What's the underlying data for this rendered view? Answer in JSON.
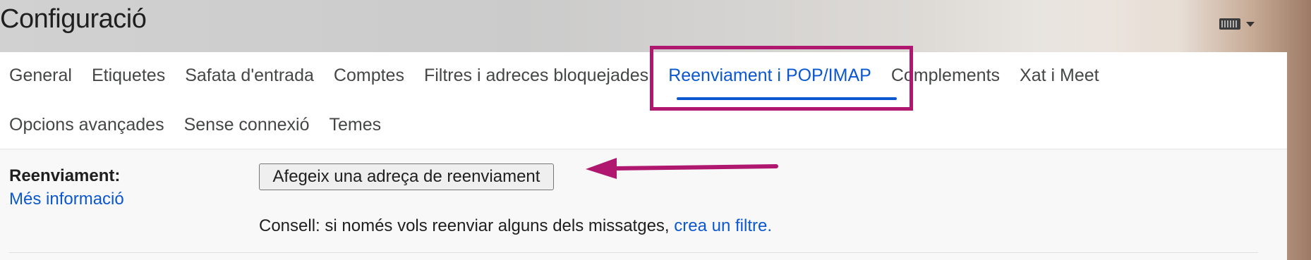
{
  "header": {
    "title": "Configuració",
    "keyboard_icon": "keyboard-icon",
    "caret_icon": "caret-down-icon"
  },
  "tabs": {
    "row1": [
      {
        "label": "General"
      },
      {
        "label": "Etiquetes"
      },
      {
        "label": "Safata d'entrada"
      },
      {
        "label": "Comptes"
      },
      {
        "label": "Filtres i adreces bloquejades"
      },
      {
        "label": "Reenviament i POP/IMAP",
        "active": true
      },
      {
        "label": "Complements"
      },
      {
        "label": "Xat i Meet"
      }
    ],
    "row2": [
      {
        "label": "Opcions avançades"
      },
      {
        "label": "Sense connexió"
      },
      {
        "label": "Temes"
      }
    ]
  },
  "forwarding": {
    "label": "Reenviament:",
    "more_info": "Més informació",
    "add_button": "Afegeix una adreça de reenviament",
    "tip_text": "Consell: si només vols reenviar alguns dels missatges, ",
    "tip_link": "crea un filtre."
  },
  "colors": {
    "accent": "#0b57d0",
    "annotation": "#b0176e"
  }
}
